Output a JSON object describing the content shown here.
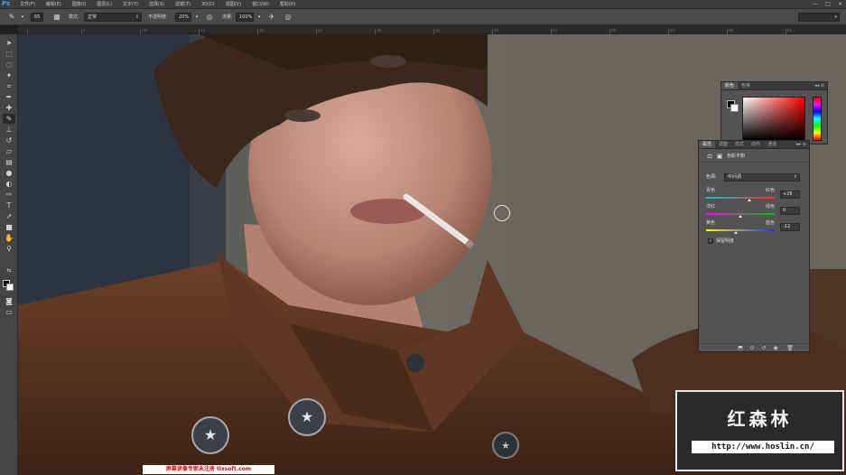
{
  "app": {
    "logo": "Ps"
  },
  "menu": [
    "文件(F)",
    "编辑(E)",
    "图像(I)",
    "图层(L)",
    "文字(Y)",
    "选择(S)",
    "滤镜(T)",
    "3D(D)",
    "视图(V)",
    "窗口(W)",
    "帮助(H)"
  ],
  "window_controls": [
    "—",
    "□",
    "✕"
  ],
  "options": {
    "brush_size": "65",
    "mode_label": "模式:",
    "mode_value": "正常",
    "opacity_label": "不透明度:",
    "opacity_value": "20%",
    "flow_label": "流量:",
    "flow_value": "100%"
  },
  "ruler_labels": [
    "5",
    "10",
    "15",
    "20",
    "25",
    "30",
    "35",
    "40",
    "45",
    "50",
    "55",
    "60",
    "65"
  ],
  "color_panel": {
    "tabs": [
      "颜色",
      "色板"
    ],
    "controls": "◂◂ ≡",
    "fg": "#000000",
    "bg": "#ffffff",
    "hue": "#ff0000"
  },
  "properties_panel": {
    "tabs": [
      "属性",
      "调整",
      "样式",
      "动作",
      "通道"
    ],
    "controls": "▸▸ ≡",
    "title": "色彩平衡",
    "tone_label": "色调:",
    "tone_value": "中间调",
    "sliders": [
      {
        "left": "青色",
        "right": "红色",
        "value": "+26",
        "level": 0.63,
        "gradient": "linear-gradient(to right,#00c8c8,#ff2a2a)"
      },
      {
        "left": "洋红",
        "right": "绿色",
        "value": "0",
        "level": 0.5,
        "gradient": "linear-gradient(to right,#ff00ff,#00c800)"
      },
      {
        "left": "黄色",
        "right": "蓝色",
        "value": "-12",
        "level": 0.44,
        "gradient": "linear-gradient(to right,#ffff00,#2a2aff)"
      }
    ],
    "preserve_label": "保留明度",
    "preserve_checked": true
  },
  "watermark": {
    "title": "红森林",
    "url": "http://www.hoslin.cn/"
  },
  "bottom_watermark": "屏幕录像专家未注册 tlxsoft.com"
}
